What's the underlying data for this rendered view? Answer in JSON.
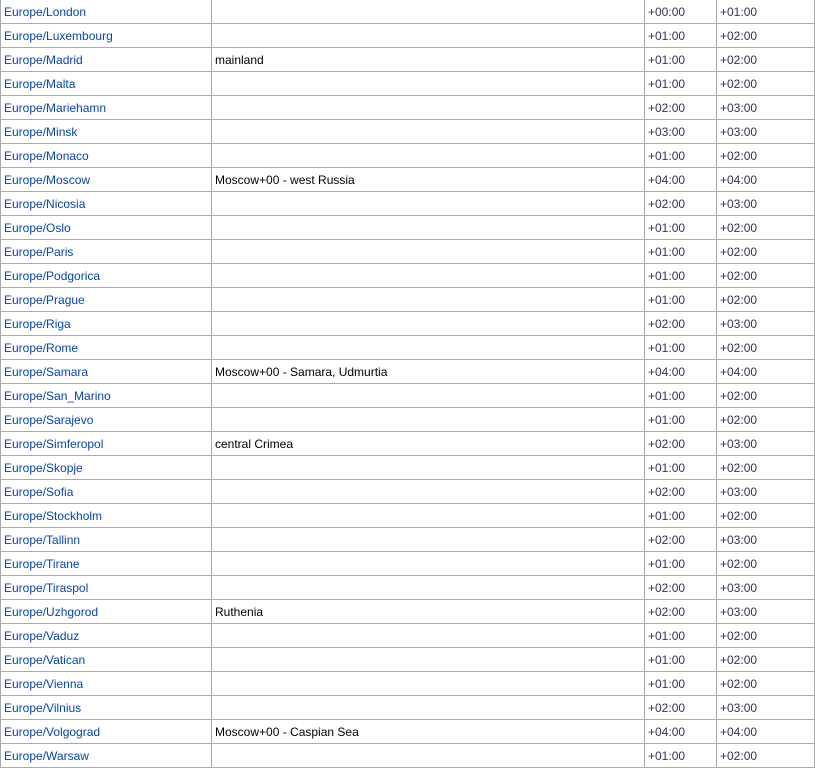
{
  "table": {
    "rows": [
      {
        "tz": "Europe/London",
        "comment": "",
        "std": "+00:00",
        "dst": "+01:00"
      },
      {
        "tz": "Europe/Luxembourg",
        "comment": "",
        "std": "+01:00",
        "dst": "+02:00"
      },
      {
        "tz": "Europe/Madrid",
        "comment": "mainland",
        "std": "+01:00",
        "dst": "+02:00"
      },
      {
        "tz": "Europe/Malta",
        "comment": "",
        "std": "+01:00",
        "dst": "+02:00"
      },
      {
        "tz": "Europe/Mariehamn",
        "comment": "",
        "std": "+02:00",
        "dst": "+03:00"
      },
      {
        "tz": "Europe/Minsk",
        "comment": "",
        "std": "+03:00",
        "dst": "+03:00"
      },
      {
        "tz": "Europe/Monaco",
        "comment": "",
        "std": "+01:00",
        "dst": "+02:00"
      },
      {
        "tz": "Europe/Moscow",
        "comment": "Moscow+00 - west Russia",
        "std": "+04:00",
        "dst": "+04:00"
      },
      {
        "tz": "Europe/Nicosia",
        "comment": "",
        "std": "+02:00",
        "dst": "+03:00"
      },
      {
        "tz": "Europe/Oslo",
        "comment": "",
        "std": "+01:00",
        "dst": "+02:00"
      },
      {
        "tz": "Europe/Paris",
        "comment": "",
        "std": "+01:00",
        "dst": "+02:00"
      },
      {
        "tz": "Europe/Podgorica",
        "comment": "",
        "std": "+01:00",
        "dst": "+02:00"
      },
      {
        "tz": "Europe/Prague",
        "comment": "",
        "std": "+01:00",
        "dst": "+02:00"
      },
      {
        "tz": "Europe/Riga",
        "comment": "",
        "std": "+02:00",
        "dst": "+03:00"
      },
      {
        "tz": "Europe/Rome",
        "comment": "",
        "std": "+01:00",
        "dst": "+02:00"
      },
      {
        "tz": "Europe/Samara",
        "comment": "Moscow+00 - Samara, Udmurtia",
        "std": "+04:00",
        "dst": "+04:00"
      },
      {
        "tz": "Europe/San_Marino",
        "comment": "",
        "std": "+01:00",
        "dst": "+02:00"
      },
      {
        "tz": "Europe/Sarajevo",
        "comment": "",
        "std": "+01:00",
        "dst": "+02:00"
      },
      {
        "tz": "Europe/Simferopol",
        "comment": "central Crimea",
        "std": "+02:00",
        "dst": "+03:00"
      },
      {
        "tz": "Europe/Skopje",
        "comment": "",
        "std": "+01:00",
        "dst": "+02:00"
      },
      {
        "tz": "Europe/Sofia",
        "comment": "",
        "std": "+02:00",
        "dst": "+03:00"
      },
      {
        "tz": "Europe/Stockholm",
        "comment": "",
        "std": "+01:00",
        "dst": "+02:00"
      },
      {
        "tz": "Europe/Tallinn",
        "comment": "",
        "std": "+02:00",
        "dst": "+03:00"
      },
      {
        "tz": "Europe/Tirane",
        "comment": "",
        "std": "+01:00",
        "dst": "+02:00"
      },
      {
        "tz": "Europe/Tiraspol",
        "comment": "",
        "std": "+02:00",
        "dst": "+03:00"
      },
      {
        "tz": "Europe/Uzhgorod",
        "comment": "Ruthenia",
        "std": "+02:00",
        "dst": "+03:00"
      },
      {
        "tz": "Europe/Vaduz",
        "comment": "",
        "std": "+01:00",
        "dst": "+02:00"
      },
      {
        "tz": "Europe/Vatican",
        "comment": "",
        "std": "+01:00",
        "dst": "+02:00"
      },
      {
        "tz": "Europe/Vienna",
        "comment": "",
        "std": "+01:00",
        "dst": "+02:00"
      },
      {
        "tz": "Europe/Vilnius",
        "comment": "",
        "std": "+02:00",
        "dst": "+03:00"
      },
      {
        "tz": "Europe/Volgograd",
        "comment": "Moscow+00 - Caspian Sea",
        "std": "+04:00",
        "dst": "+04:00"
      },
      {
        "tz": "Europe/Warsaw",
        "comment": "",
        "std": "+01:00",
        "dst": "+02:00"
      }
    ]
  }
}
